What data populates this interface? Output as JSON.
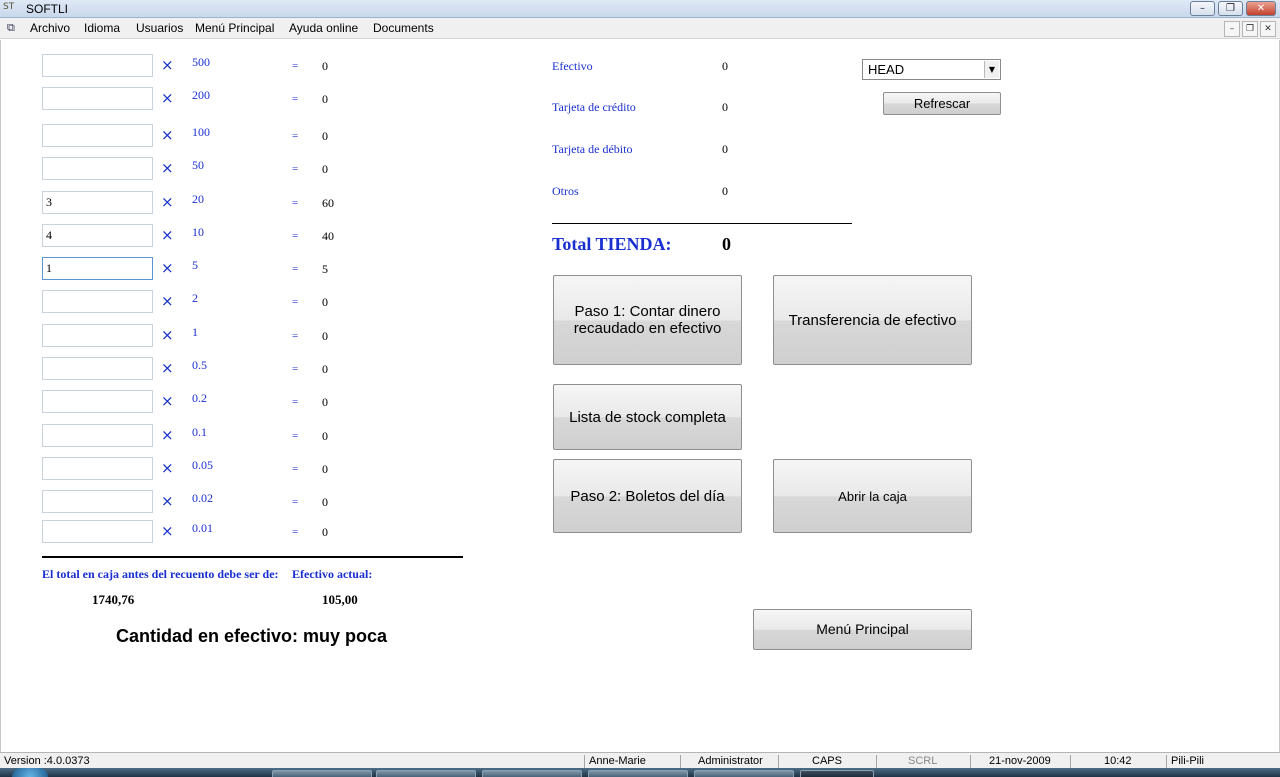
{
  "window": {
    "title": "SOFTLI",
    "app_icon": "ST"
  },
  "menubar": {
    "items": [
      "Archivo",
      "Idioma",
      "Usuarios",
      "Menú Principal",
      "Ayuda online",
      "Documents"
    ]
  },
  "denominations": [
    {
      "qty": "",
      "denom": "500",
      "result": "0"
    },
    {
      "qty": "",
      "denom": "200",
      "result": "0"
    },
    {
      "qty": "",
      "denom": "100",
      "result": "0"
    },
    {
      "qty": "",
      "denom": "50",
      "result": "0"
    },
    {
      "qty": "3",
      "denom": "20",
      "result": "60"
    },
    {
      "qty": "4",
      "denom": "10",
      "result": "40"
    },
    {
      "qty": "1",
      "denom": "5",
      "result": "5"
    },
    {
      "qty": "",
      "denom": "2",
      "result": "0"
    },
    {
      "qty": "",
      "denom": "1",
      "result": "0"
    },
    {
      "qty": "",
      "denom": "0.5",
      "result": "0"
    },
    {
      "qty": "",
      "denom": "0.2",
      "result": "0"
    },
    {
      "qty": "",
      "denom": "0.1",
      "result": "0"
    },
    {
      "qty": "",
      "denom": "0.05",
      "result": "0"
    },
    {
      "qty": "",
      "denom": "0.02",
      "result": "0"
    },
    {
      "qty": "",
      "denom": "0.01",
      "result": "0"
    }
  ],
  "symbols": {
    "times": "×",
    "equals": "="
  },
  "totals": {
    "expected_label": "El total en caja antes del recuento debe ser de:",
    "expected_value": "1740,76",
    "current_label": "Efectivo actual:",
    "current_value": "105,00",
    "status_message": "Cantidad en efectivo: muy poca"
  },
  "payments": [
    {
      "label": "Efectivo",
      "value": "0"
    },
    {
      "label": "Tarjeta de crédito",
      "value": "0"
    },
    {
      "label": "Tarjeta de débito",
      "value": "0"
    },
    {
      "label": "Otros",
      "value": "0"
    }
  ],
  "store_total": {
    "label": "Total TIENDA:",
    "value": "0"
  },
  "store_select": {
    "value": "HEAD"
  },
  "buttons": {
    "refresh": "Refrescar",
    "step1": "Paso 1: Contar dinero recaudado en efectivo",
    "transfer": "Transferencia de efectivo",
    "stock": "Lista de stock completa",
    "step2": "Paso 2: Boletos del día",
    "open_drawer": "Abrir la caja",
    "main_menu": "Menú Principal"
  },
  "statusbar": {
    "version": "Version :4.0.0373",
    "user": "Anne-Marie",
    "role": "Administrator",
    "caps": "CAPS",
    "scrl": "SCRL",
    "date": "21-nov-2009",
    "time": "10:42",
    "store": "Pili-Pili"
  },
  "colors": {
    "label_blue": "#1a2fd0",
    "times_blue": "#1530c8"
  }
}
